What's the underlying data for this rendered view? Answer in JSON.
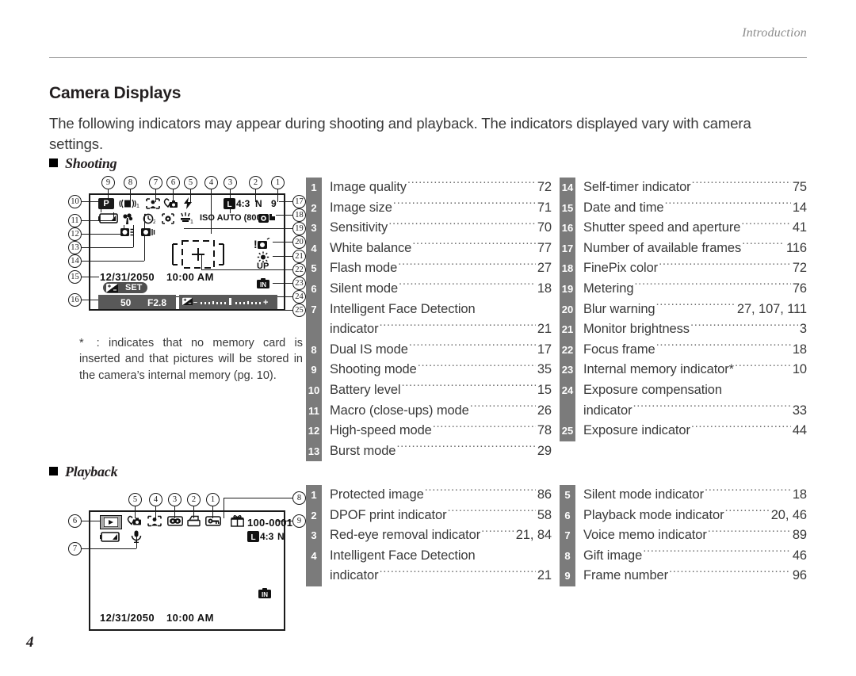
{
  "running_head": "Introduction",
  "page_title": "Camera Displays",
  "intro": "The following indicators may appear during shooting and playback.  The indicators displayed vary with camera settings.",
  "folio": "4",
  "sections": {
    "shooting": {
      "label": "Shooting"
    },
    "playback": {
      "label": "Playback"
    }
  },
  "footnote": {
    "star": "*",
    "text": ": indicates that no memory card is inserted and that pictures will be stored in the camera’s internal memory (pg. 10)."
  },
  "shooting_display": {
    "callouts": [
      "1",
      "2",
      "3",
      "4",
      "5",
      "6",
      "7",
      "8",
      "9",
      "10",
      "11",
      "12",
      "13",
      "14",
      "15",
      "16",
      "17",
      "18",
      "19",
      "20",
      "21",
      "22",
      "23",
      "24",
      "25"
    ],
    "mode_icon": "program-mode-icon",
    "stabilizer_icon": "dual-is-icon",
    "stabilizer_label": "1",
    "face_detect_icon": "face-detection-icon",
    "silent_icon": "silent-mode-icon",
    "flash_icon": "flash-icon",
    "battery_icon": "battery-level-icon",
    "macro_icon": "macro-flower-icon",
    "selftimer_icon": "self-timer-icon",
    "selftimer_label": "2",
    "metering_icon": "metering-icon",
    "whitebalance_icon": "white-balance-icon",
    "whitebalance_label": "1",
    "highspeed_icon": "high-speed-mode-icon",
    "burst_icon": "burst-mode-icon",
    "image_size_icon": "image-size-L-icon",
    "aspect_ratio": "4:3",
    "quality": "N",
    "frames_remaining": "9",
    "sensitivity": "ISO AUTO (800)",
    "finepix_color_icon": "finepix-color-icon",
    "blur_warning_icon": "blur-warning-icon",
    "monitor_brightness_icon": "monitor-brightness-icon",
    "monitor_brightness_label": "UP",
    "internal_memory_icon": "internal-memory-icon",
    "focus_frame_icon": "focus-frame-icon",
    "date": "12/31/2050",
    "time": "10:00 AM",
    "exp_comp_button": "SET",
    "shutter_speed": "50",
    "aperture": "F2.8",
    "exposure_indicator_minus": "–",
    "exposure_indicator_plus": "+"
  },
  "playback_display": {
    "callouts": [
      "1",
      "2",
      "3",
      "4",
      "5",
      "6",
      "7",
      "8",
      "9"
    ],
    "playback_mode_icon": "playback-mode-icon",
    "silent_icon": "silent-mode-icon",
    "face_detect_icon": "face-detection-icon",
    "redeye_icon": "red-eye-removal-icon",
    "dpof_icon": "dpof-print-icon",
    "protect_icon": "protected-image-icon",
    "gift_icon": "gift-image-icon",
    "frame_number": "100-0001",
    "image_size_icon": "image-size-L-icon",
    "aspect_ratio": "4:3",
    "quality": "N",
    "battery_icon": "battery-level-icon",
    "voice_memo_icon": "voice-memo-icon",
    "internal_memory_icon": "internal-memory-icon",
    "date": "12/31/2050",
    "time": "10:00 AM"
  },
  "shooting_list_left": [
    {
      "num": "1",
      "label": "Image quality",
      "page": "72"
    },
    {
      "num": "2",
      "label": "Image size",
      "page": "71"
    },
    {
      "num": "3",
      "label": "Sensitivity",
      "page": "70"
    },
    {
      "num": "4",
      "label": "White balance",
      "page": "77"
    },
    {
      "num": "5",
      "label": "Flash mode",
      "page": "27"
    },
    {
      "num": "6",
      "label": "Silent mode",
      "page": "18"
    },
    {
      "num": "7",
      "label": "Intelligent Face Detection",
      "page": "",
      "nodots": true
    },
    {
      "num": "",
      "label": "indicator",
      "page": "21"
    },
    {
      "num": "8",
      "label": "Dual IS mode",
      "page": "17"
    },
    {
      "num": "9",
      "label": "Shooting mode",
      "page": "35"
    },
    {
      "num": "10",
      "label": "Battery level",
      "page": "15"
    },
    {
      "num": "11",
      "label": "Macro (close-ups) mode",
      "page": "26"
    },
    {
      "num": "12",
      "label": "High-speed mode",
      "page": "78"
    },
    {
      "num": "13",
      "label": "Burst mode",
      "page": "29"
    }
  ],
  "shooting_list_right": [
    {
      "num": "14",
      "label": "Self-timer indicator",
      "page": "75"
    },
    {
      "num": "15",
      "label": "Date and time",
      "page": "14"
    },
    {
      "num": "16",
      "label": "Shutter speed and aperture",
      "page": "41"
    },
    {
      "num": "17",
      "label": "Number of available frames",
      "page": "116"
    },
    {
      "num": "18",
      "label": "FinePix color",
      "page": "72"
    },
    {
      "num": "19",
      "label": "Metering",
      "page": "76"
    },
    {
      "num": "20",
      "label": "Blur warning",
      "page": "27, 107, 111"
    },
    {
      "num": "21",
      "label": "Monitor brightness",
      "page": "3"
    },
    {
      "num": "22",
      "label": "Focus frame",
      "page": "18"
    },
    {
      "num": "23",
      "label": "Internal memory indicator*",
      "page": "10"
    },
    {
      "num": "24",
      "label": "Exposure compensation",
      "page": "",
      "nodots": true
    },
    {
      "num": "",
      "label": "indicator",
      "page": "33"
    },
    {
      "num": "25",
      "label": "Exposure indicator",
      "page": "44"
    }
  ],
  "playback_list_left": [
    {
      "num": "1",
      "label": "Protected image",
      "page": "86"
    },
    {
      "num": "2",
      "label": "DPOF print indicator",
      "page": "58"
    },
    {
      "num": "3",
      "label": "Red-eye removal indicator",
      "page": "21, 84"
    },
    {
      "num": "4",
      "label": "Intelligent Face Detection",
      "page": "",
      "nodots": true
    },
    {
      "num": "",
      "label": "indicator",
      "page": "21"
    }
  ],
  "playback_list_right": [
    {
      "num": "5",
      "label": "Silent mode indicator",
      "page": "18"
    },
    {
      "num": "6",
      "label": "Playback mode indicator",
      "page": "20, 46"
    },
    {
      "num": "7",
      "label": "Voice memo indicator",
      "page": "89"
    },
    {
      "num": "8",
      "label": "Gift image",
      "page": "46"
    },
    {
      "num": "9",
      "label": "Frame number",
      "page": "96"
    }
  ]
}
